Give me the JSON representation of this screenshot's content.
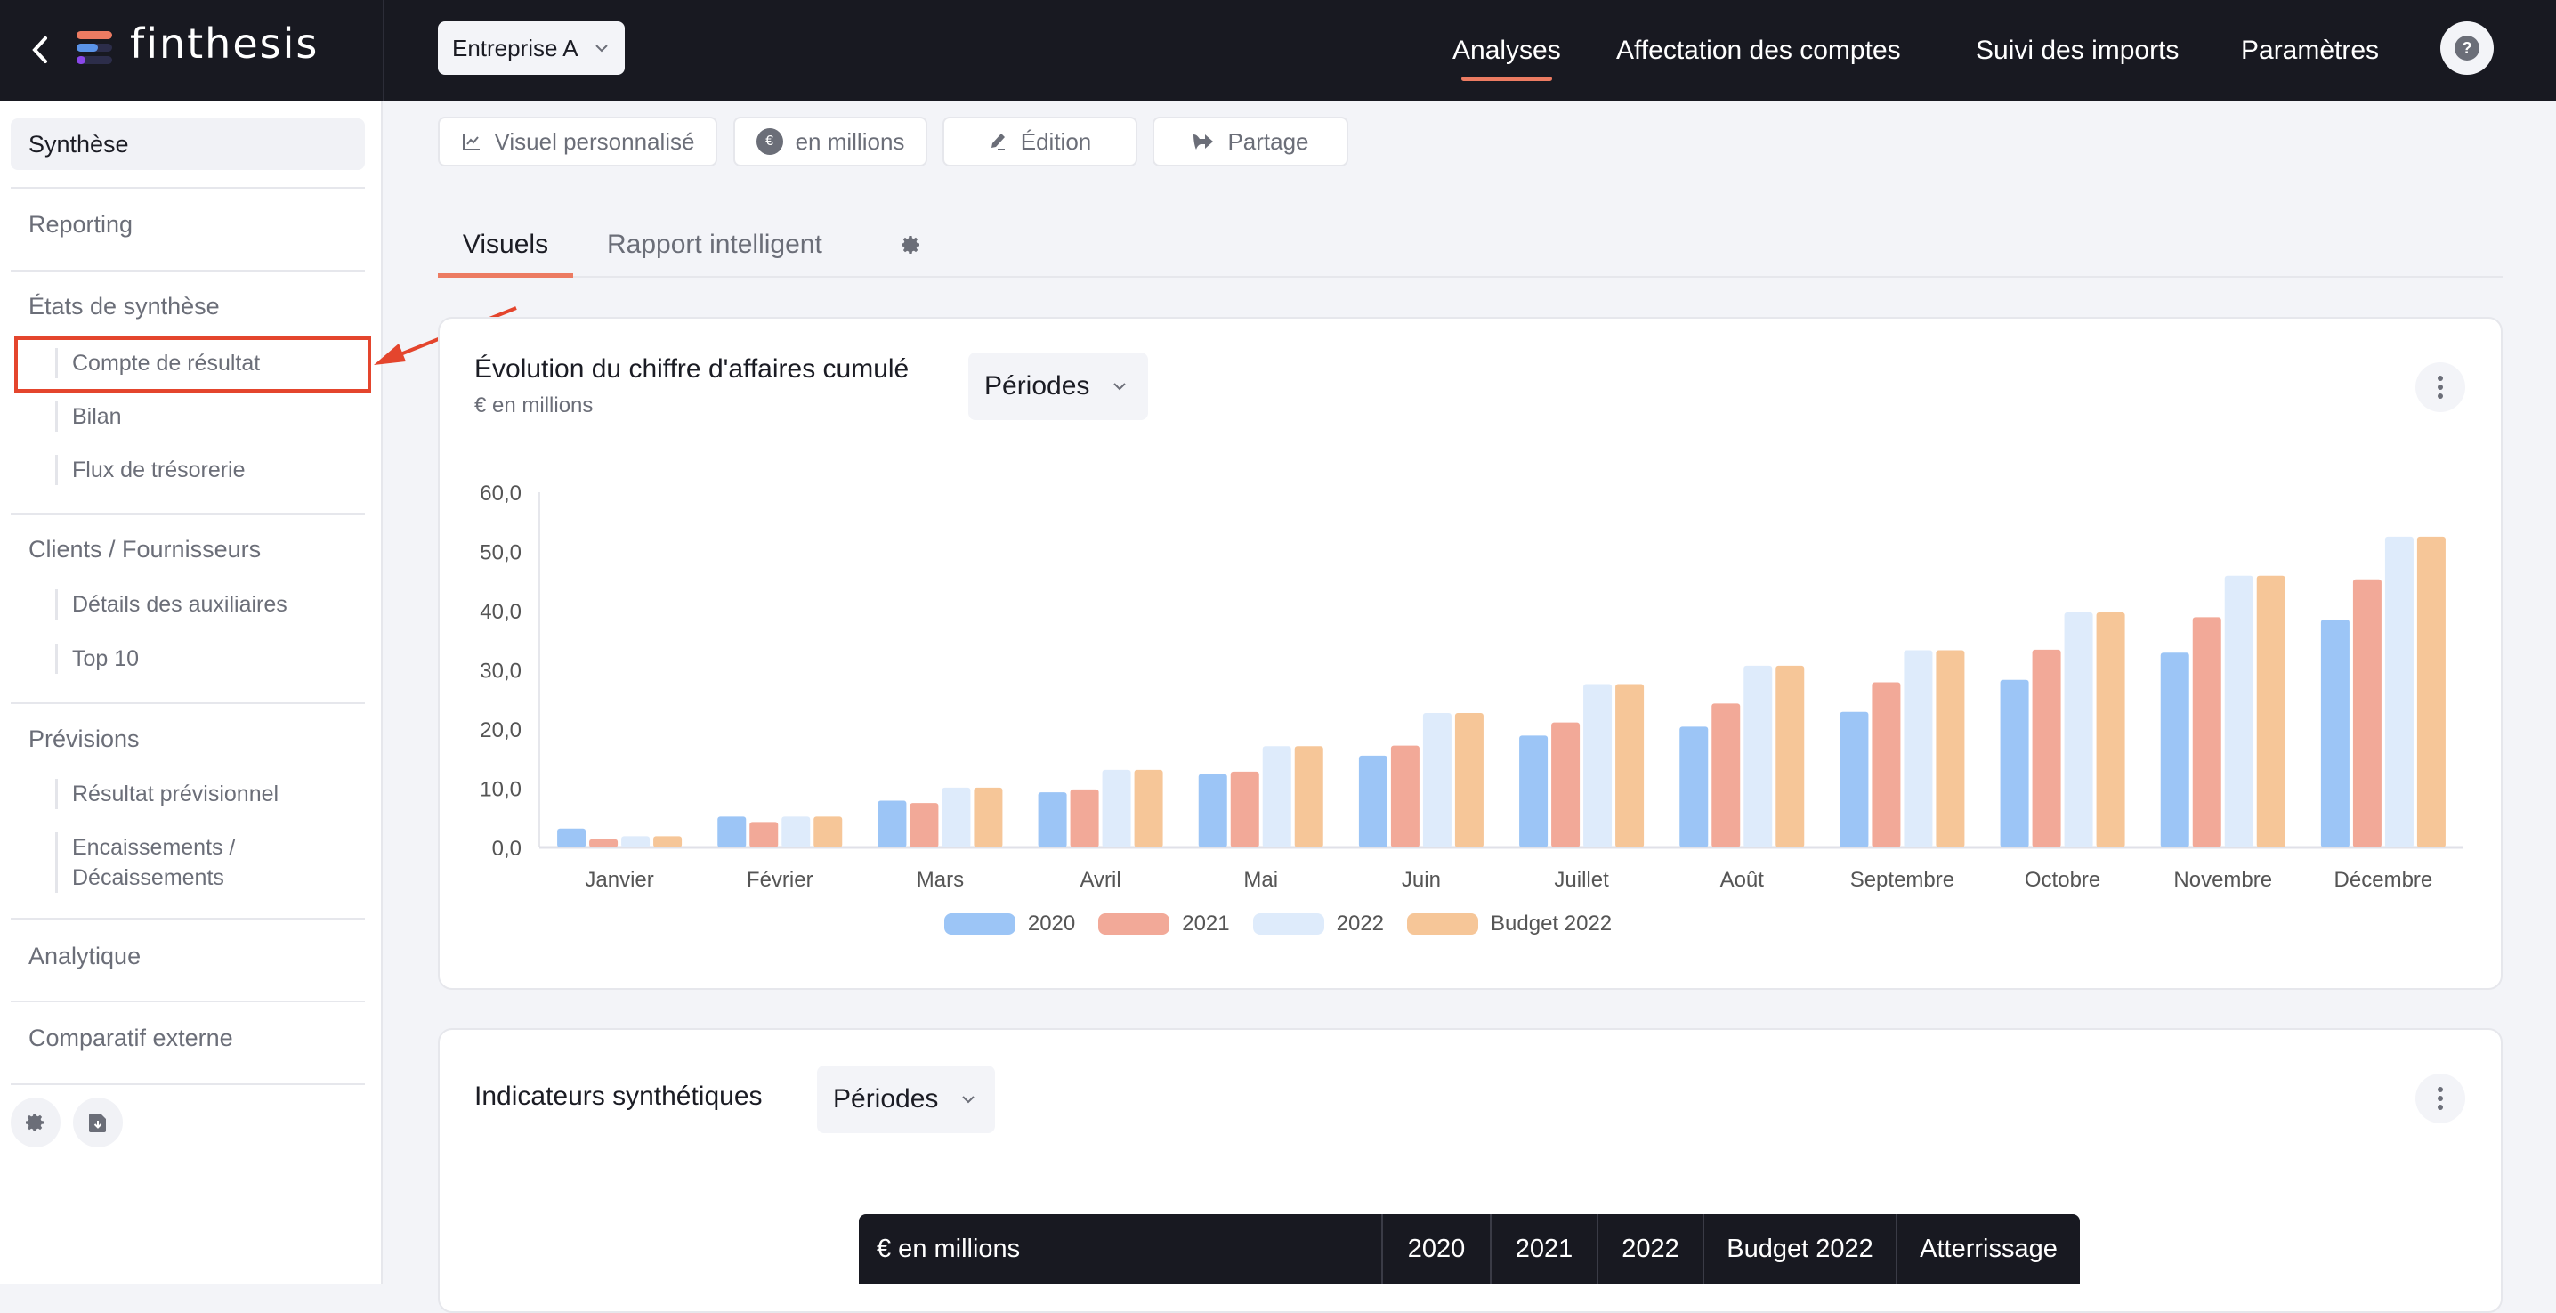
{
  "header": {
    "logo_text": "finthesis",
    "company_selector": "Entreprise A",
    "nav": [
      {
        "label": "Analyses",
        "active": true
      },
      {
        "label": "Affectation des comptes",
        "active": false
      },
      {
        "label": "Suivi des imports",
        "active": false
      },
      {
        "label": "Paramètres",
        "active": false
      }
    ],
    "help_label": "?"
  },
  "sidebar": {
    "items": [
      {
        "label": "Synthèse",
        "active": true
      },
      {
        "label": "Reporting"
      },
      {
        "label": "États de synthèse",
        "children": [
          "Compte de résultat",
          "Bilan",
          "Flux de trésorerie"
        ]
      },
      {
        "label": "Clients / Fournisseurs",
        "children": [
          "Détails des auxiliaires",
          "Top 10"
        ]
      },
      {
        "label": "Prévisions",
        "children": [
          "Résultat prévisionnel",
          "Encaissements / Décaissements"
        ]
      },
      {
        "label": "Analytique"
      },
      {
        "label": "Comparatif externe"
      }
    ],
    "highlighted_item": "Compte de résultat"
  },
  "toolbar": {
    "custom_visual": "Visuel personnalisé",
    "units": "en millions",
    "edit": "Édition",
    "share": "Partage"
  },
  "tabs": [
    {
      "label": "Visuels",
      "active": true
    },
    {
      "label": "Rapport intelligent",
      "active": false
    }
  ],
  "revenue_card": {
    "title": "Évolution du chiffre d'affaires cumulé",
    "subtitle": "€ en millions",
    "period_selector": "Périodes"
  },
  "indicators_card": {
    "title": "Indicateurs synthétiques",
    "period_selector": "Périodes",
    "table_headers": [
      "€ en millions",
      "2020",
      "2021",
      "2022",
      "Budget 2022",
      "Atterrissage"
    ]
  },
  "colors": {
    "accent": "#ec7b62",
    "header_bg": "#181921",
    "annotation": "#e4452d"
  },
  "chart_data": {
    "type": "bar",
    "title": "Évolution du chiffre d'affaires cumulé",
    "subtitle": "€ en millions",
    "xlabel": "",
    "ylabel": "",
    "ylim": [
      0,
      60
    ],
    "yticks": [
      "0,0",
      "10,0",
      "20,0",
      "30,0",
      "40,0",
      "50,0",
      "60,0"
    ],
    "grid": false,
    "legend_position": "bottom-center",
    "categories": [
      "Janvier",
      "Février",
      "Mars",
      "Avril",
      "Mai",
      "Juin",
      "Juillet",
      "Août",
      "Septembre",
      "Octobre",
      "Novembre",
      "Décembre"
    ],
    "series": [
      {
        "name": "2020",
        "color": "#9cc5f6",
        "values": [
          3.2,
          5.2,
          7.9,
          9.3,
          12.4,
          15.5,
          18.9,
          20.4,
          22.9,
          28.3,
          32.9,
          38.5
        ]
      },
      {
        "name": "2021",
        "color": "#f2a998",
        "values": [
          1.4,
          4.3,
          7.5,
          9.8,
          12.8,
          17.2,
          21.1,
          24.3,
          27.9,
          33.4,
          38.9,
          45.3
        ]
      },
      {
        "name": "2022",
        "color": "#deebfb",
        "values": [
          1.9,
          5.2,
          10.1,
          13.1,
          17.1,
          22.7,
          27.6,
          30.7,
          33.3,
          39.7,
          45.9,
          52.5
        ]
      },
      {
        "name": "Budget 2022",
        "color": "#f6c698",
        "values": [
          1.9,
          5.2,
          10.1,
          13.1,
          17.1,
          22.7,
          27.6,
          30.7,
          33.3,
          39.7,
          45.9,
          52.5
        ]
      }
    ]
  }
}
